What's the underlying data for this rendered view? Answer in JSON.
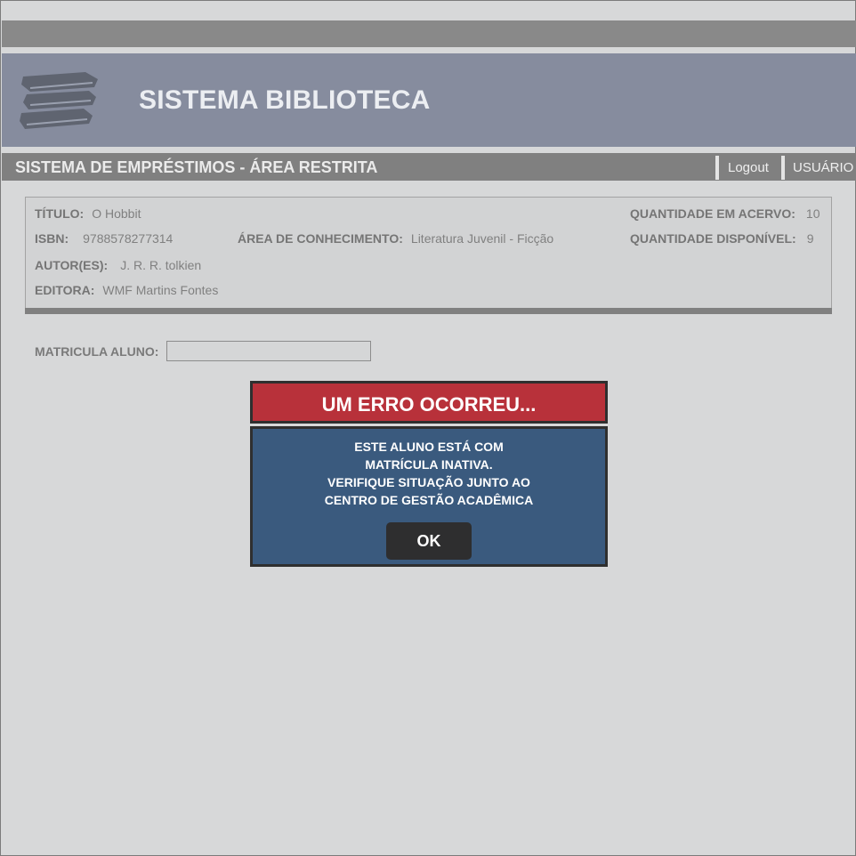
{
  "header": {
    "app_title": "SISTEMA BIBLIOTECA",
    "logo_icon": "books-stack-icon"
  },
  "nav": {
    "section_title": "SISTEMA DE EMPRÉSTIMOS - ÁREA RESTRITA",
    "logout_label": "Logout",
    "user_label": "USUÁRIO"
  },
  "book": {
    "title_label": "TÍTULO:",
    "title_value": "O Hobbit",
    "isbn_label": "ISBN:",
    "isbn_value": "9788578277314",
    "area_label": "ÁREA DE CONHECIMENTO:",
    "area_value": "Literatura Juvenil - Ficção",
    "author_label": "AUTOR(ES):",
    "author_value": "J. R. R. tolkien",
    "publisher_label": "EDITORA:",
    "publisher_value": "WMF Martins Fontes",
    "stock_label": "QUANTIDADE EM ACERVO:",
    "stock_value": "10",
    "available_label": "QUANTIDADE DISPONÍVEL:",
    "available_value": "9"
  },
  "form": {
    "matricula_label": "MATRICULA ALUNO:",
    "matricula_value": ""
  },
  "error_dialog": {
    "title": "UM ERRO OCORREU...",
    "message_lines": [
      "ESTE ALUNO ESTÁ COM",
      "MATRÍCULA INATIVA.",
      "VERIFIQUE SITUAÇÃO JUNTO AO",
      "CENTRO DE GESTÃO ACADÊMICA"
    ],
    "ok_label": "OK"
  },
  "colors": {
    "header_bg": "#868c9e",
    "nav_bg": "#808080",
    "dialog_header": "#b8313a",
    "dialog_body": "#3a5a7e",
    "button_bg": "#2e2e2f"
  }
}
